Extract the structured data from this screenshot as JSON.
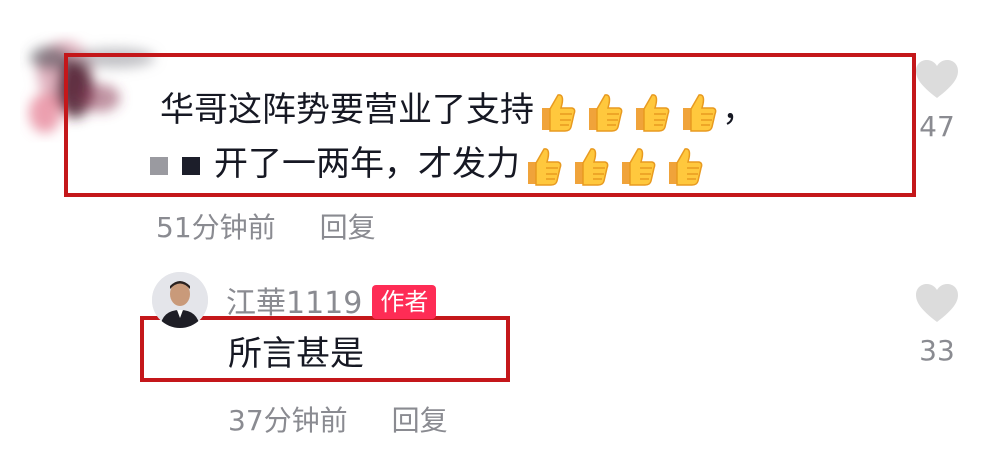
{
  "comment": {
    "line1_text": "华哥这阵势要营业了支持",
    "line1_trailing": "，",
    "line2_text": "开了一两年，才发力",
    "thumbs_per_line": 4,
    "time": "51分钟前",
    "reply_label": "回复",
    "likes": "47"
  },
  "reply": {
    "author": "江華1119",
    "badge": "作者",
    "text": "所言甚是",
    "time": "37分钟前",
    "reply_label": "回复",
    "likes": "33"
  },
  "colors": {
    "highlight_box": "#c4171a",
    "author_badge": "#fe2c55",
    "meta_text": "#8a8b91",
    "heart": "#dcdcdc"
  },
  "icons": {
    "emoji": "thumbs-up-icon",
    "like": "heart-icon"
  }
}
